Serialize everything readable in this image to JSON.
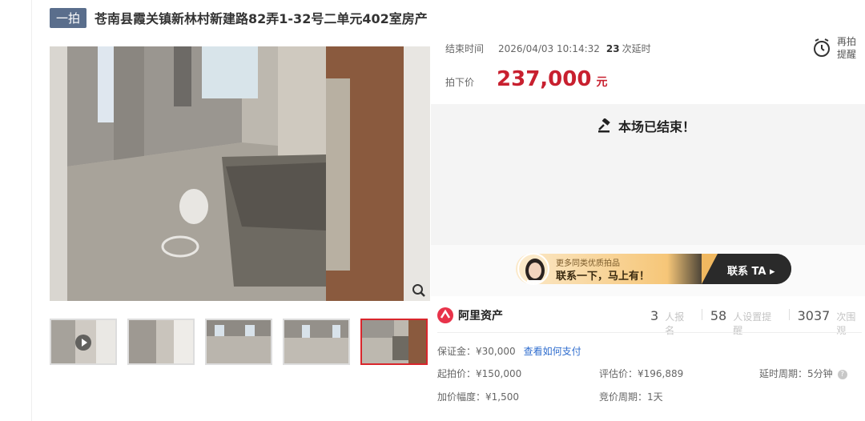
{
  "header": {
    "badge": "一拍",
    "title": "苍南县霞关镇新林村新建路82弄1-32号二单元402室房产"
  },
  "auction": {
    "end_label": "结束时间",
    "end_time": "2026/04/03 10:14:32",
    "delay_count": "23",
    "delay_label": "次延时",
    "remind_label": "再拍提醒",
    "price_label": "拍下价",
    "price": "237,000",
    "price_unit": "元",
    "ended_text": "本场已结束！"
  },
  "contact": {
    "small": "更多同类优质拍品",
    "big": "联系一下，马上有！",
    "button": "联系 TA ▸"
  },
  "brand": {
    "name": "阿里资产"
  },
  "stats": {
    "signups": "3",
    "signups_label": "人报名",
    "reminders": "58",
    "reminders_label": "人设置提醒",
    "views": "3037",
    "views_label": "次围观"
  },
  "details": {
    "deposit": "保证金：¥30,000",
    "deposit_link": "查看如何支付",
    "start_price": "起拍价：¥150,000",
    "appraisal": "评估价：¥196,889",
    "delay_period": "延时周期：5分钟",
    "increment": "加价幅度：¥1,500",
    "bid_period": "竞价周期：1天"
  },
  "colors": {
    "accent": "#c8202f",
    "badge": "#5a6e8c",
    "link": "#2f6dce"
  }
}
